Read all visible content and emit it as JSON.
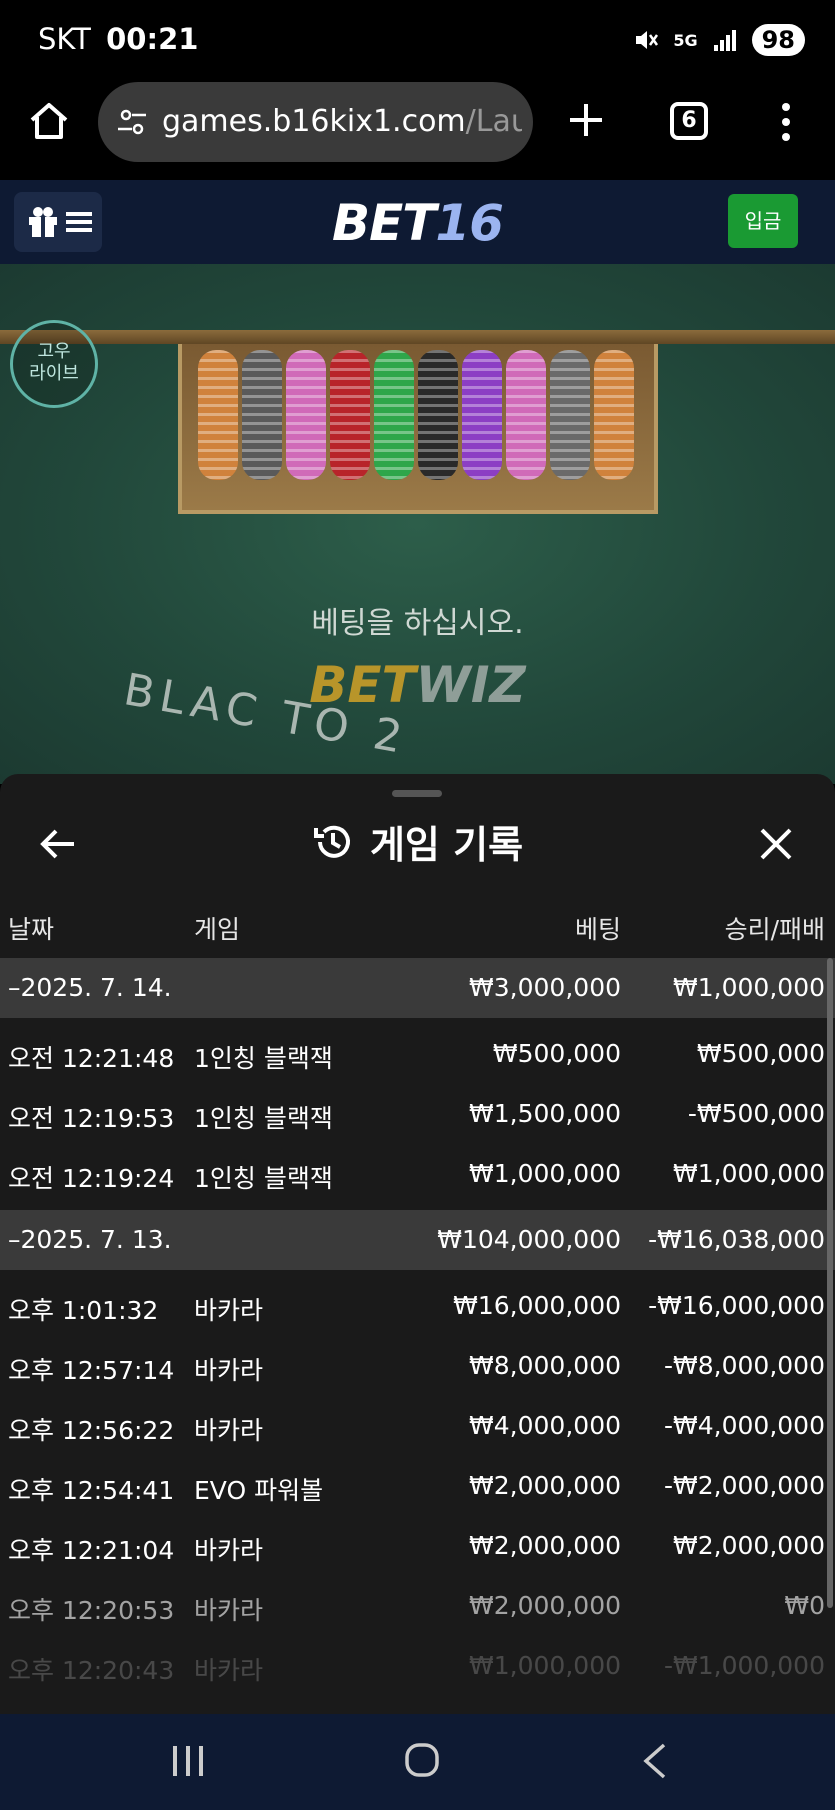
{
  "status_bar": {
    "carrier": "SKT",
    "time": "00:21",
    "network": "5G",
    "battery": "98"
  },
  "browser": {
    "url_host": "games.b16kix1.com",
    "url_path": "/Launch",
    "tab_count": "6"
  },
  "site_header": {
    "logo_main": "BET",
    "logo_num": "16",
    "login_label": "입금"
  },
  "game": {
    "badge_line1": "고우",
    "badge_line2": "라이브",
    "prompt": "베팅을 하십시오.",
    "brand_a": "BET",
    "brand_b": "WIZ",
    "table_text": "BLAC          TO 2",
    "chip_colors": [
      "#d0823c",
      "#5a5a5a",
      "#d06ab8",
      "#b8242a",
      "#2ea64a",
      "#2a2a2a",
      "#8c3ec4",
      "#d06ab8",
      "#6a6a6a",
      "#d0823c"
    ]
  },
  "history": {
    "title": "게임 기록",
    "columns": {
      "date": "날짜",
      "game": "게임",
      "bet": "베팅",
      "win": "승리/패배"
    },
    "groups": [
      {
        "date": "–2025. 7. 14.",
        "bet": "₩3,000,000",
        "win": "₩1,000,000",
        "rows": [
          {
            "time": "오전 12:21:48",
            "game": "1인칭 블랙잭",
            "bet": "₩500,000",
            "win": "₩500,000"
          },
          {
            "time": "오전 12:19:53",
            "game": "1인칭 블랙잭",
            "bet": "₩1,500,000",
            "win": "-₩500,000"
          },
          {
            "time": "오전 12:19:24",
            "game": "1인칭 블랙잭",
            "bet": "₩1,000,000",
            "win": "₩1,000,000"
          }
        ]
      },
      {
        "date": "–2025. 7. 13.",
        "bet": "₩104,000,000",
        "win": "-₩16,038,000",
        "rows": [
          {
            "time": "오후 1:01:32",
            "game": "바카라",
            "bet": "₩16,000,000",
            "win": "-₩16,000,000"
          },
          {
            "time": "오후 12:57:14",
            "game": "바카라",
            "bet": "₩8,000,000",
            "win": "-₩8,000,000"
          },
          {
            "time": "오후 12:56:22",
            "game": "바카라",
            "bet": "₩4,000,000",
            "win": "-₩4,000,000"
          },
          {
            "time": "오후 12:54:41",
            "game": "EVO 파워볼",
            "bet": "₩2,000,000",
            "win": "-₩2,000,000"
          },
          {
            "time": "오후 12:21:04",
            "game": "바카라",
            "bet": "₩2,000,000",
            "win": "₩2,000,000"
          },
          {
            "time": "오후 12:20:53",
            "game": "바카라",
            "bet": "₩2,000,000",
            "win": "₩0"
          },
          {
            "time": "오후 12:20:43",
            "game": "바카라",
            "bet": "₩1,000,000",
            "win": "-₩1,000,000"
          }
        ]
      }
    ]
  }
}
